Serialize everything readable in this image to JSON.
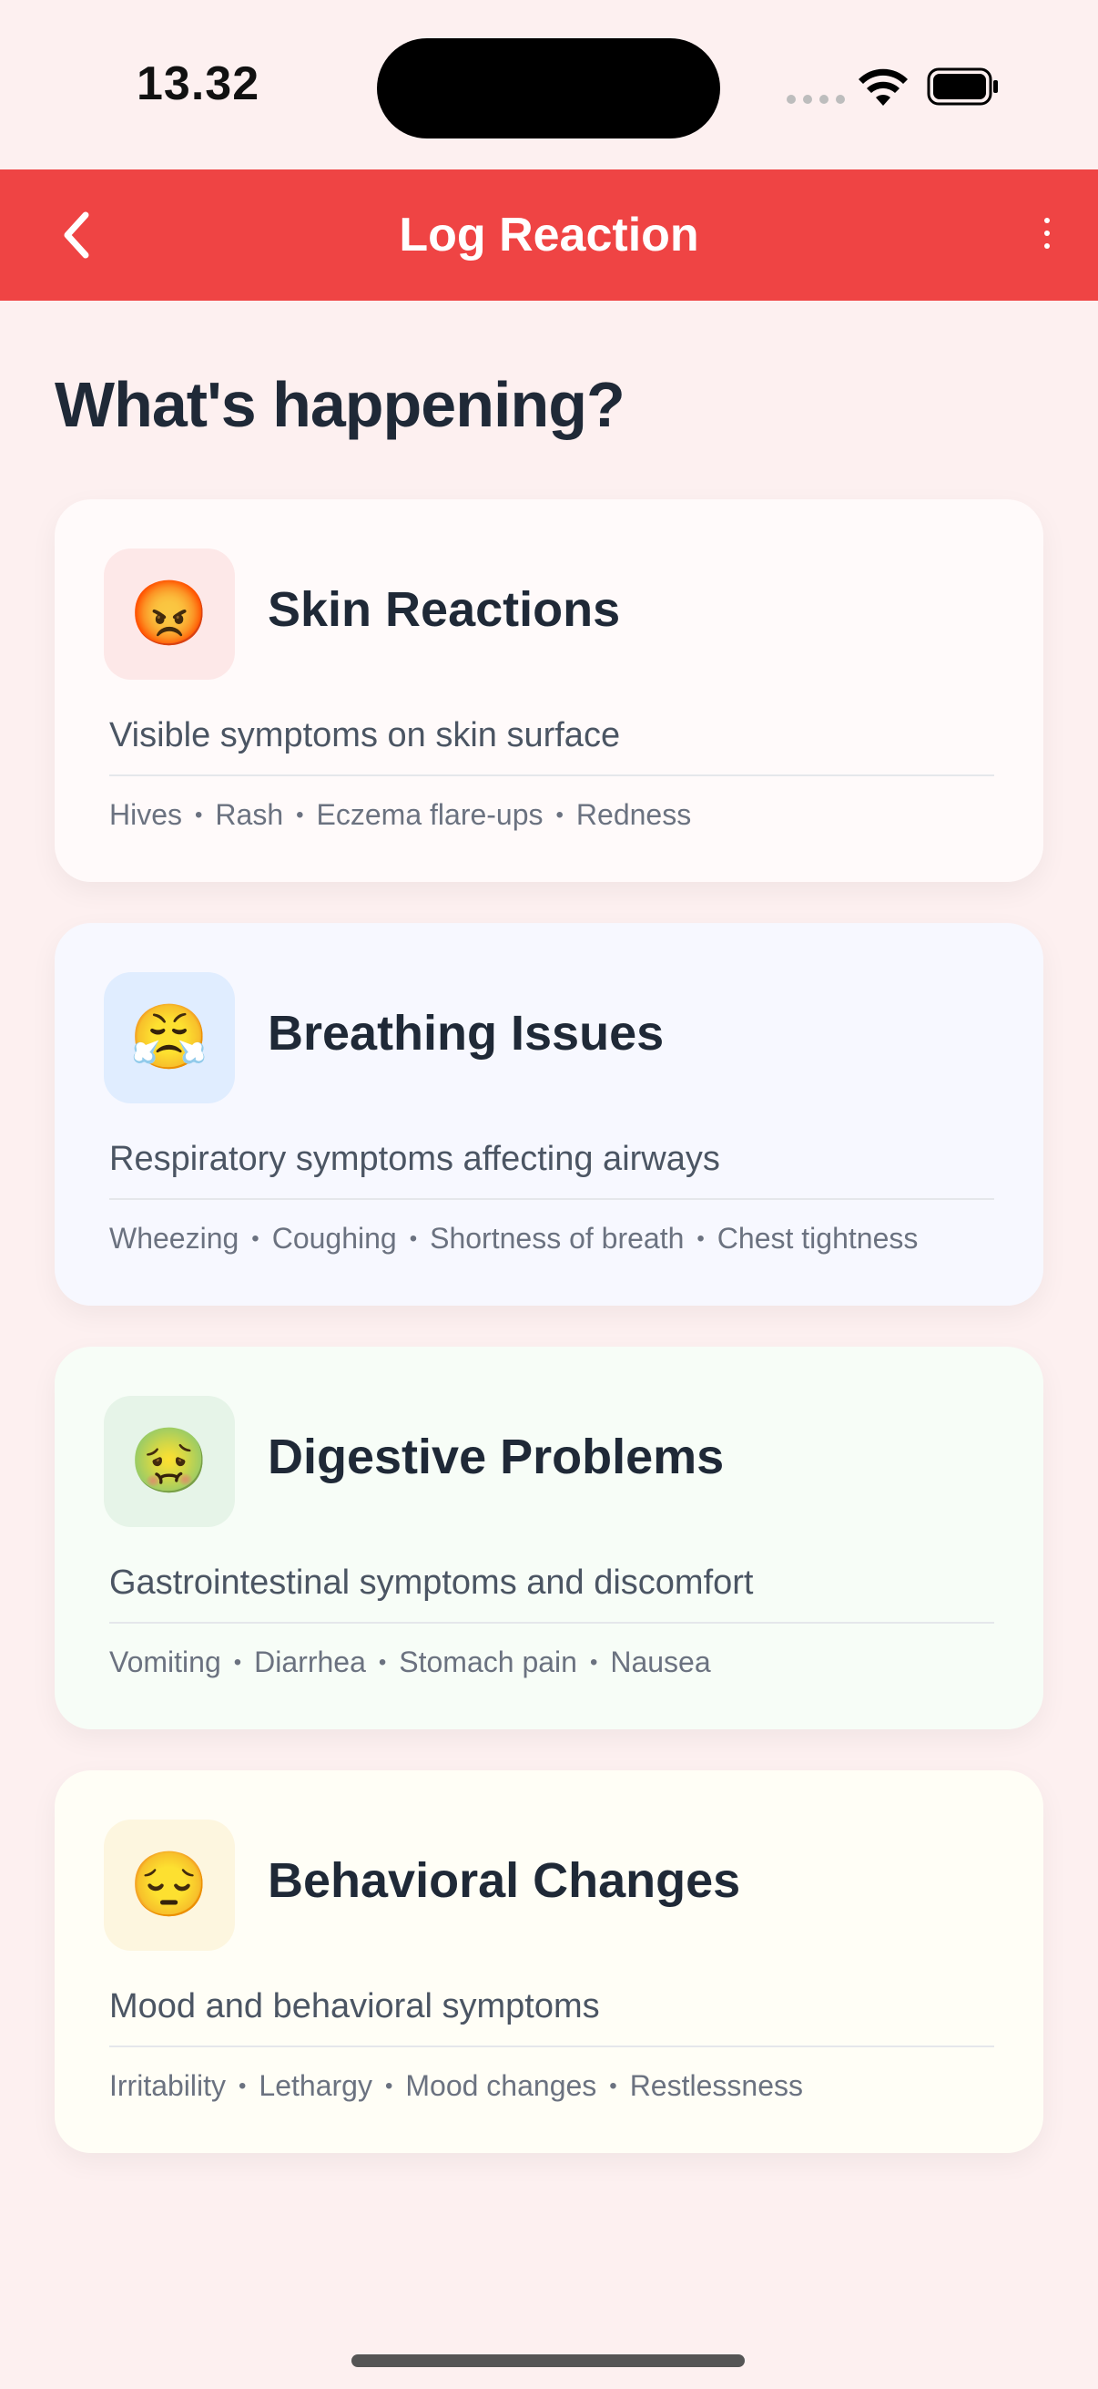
{
  "status_bar": {
    "time": "13.32"
  },
  "app_bar": {
    "title": "Log Reaction"
  },
  "heading": "What's happening?",
  "cards": [
    {
      "title": "Skin Reactions",
      "emoji": "😡",
      "icon": "angry-face-icon",
      "description": "Visible symptoms on skin surface",
      "tags": [
        "Hives",
        "Rash",
        "Eczema flare-ups",
        "Redness"
      ],
      "bg": "#fffafa",
      "icon_bg": "#fde8e8"
    },
    {
      "title": "Breathing Issues",
      "emoji": "😤",
      "icon": "face-with-steam-icon",
      "description": "Respiratory symptoms affecting airways",
      "tags": [
        "Wheezing",
        "Coughing",
        "Shortness of breath",
        "Chest tightness"
      ],
      "bg": "#f7f8ff",
      "icon_bg": "#e0edff"
    },
    {
      "title": "Digestive Problems",
      "emoji": "🤢",
      "icon": "nauseated-face-icon",
      "description": "Gastrointestinal symptoms and discomfort",
      "tags": [
        "Vomiting",
        "Diarrhea",
        "Stomach pain",
        "Nausea"
      ],
      "bg": "#f7fdf7",
      "icon_bg": "#e6f4e8"
    },
    {
      "title": "Behavioral Changes",
      "emoji": "😔",
      "icon": "pensive-face-icon",
      "description": "Mood and behavioral symptoms",
      "tags": [
        "Irritability",
        "Lethargy",
        "Mood changes",
        "Restlessness"
      ],
      "bg": "#fffef6",
      "icon_bg": "#fdf6df"
    }
  ],
  "colors": {
    "accent": "#ef4444",
    "background": "#fdf0f0"
  }
}
